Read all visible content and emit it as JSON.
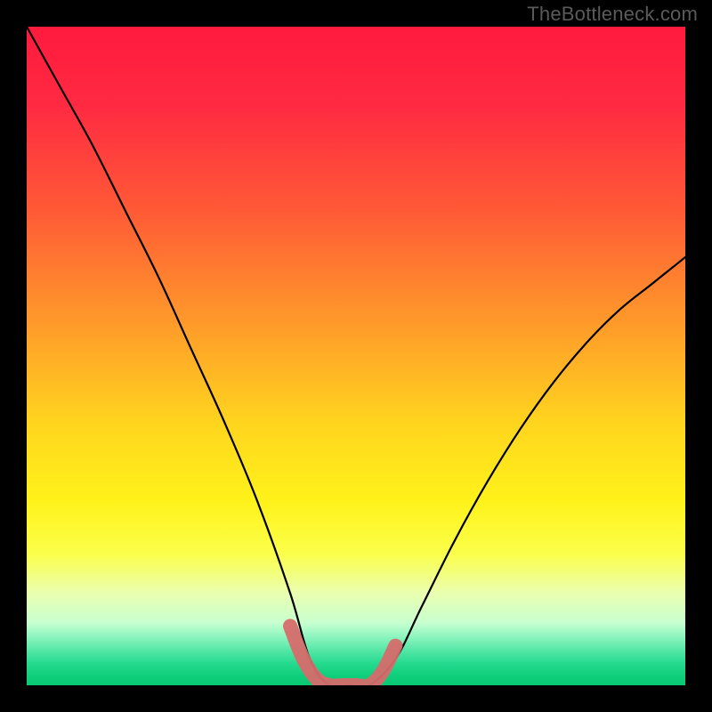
{
  "watermark": "TheBottleneck.com",
  "chart_data": {
    "type": "line",
    "title": "",
    "xlabel": "",
    "ylabel": "",
    "xlim": [
      0,
      100
    ],
    "ylim": [
      0,
      100
    ],
    "series": [
      {
        "name": "bottleneck-curve",
        "x": [
          0,
          5,
          10,
          15,
          20,
          25,
          30,
          35,
          40,
          43,
          46,
          49,
          52,
          56,
          60,
          65,
          70,
          75,
          80,
          85,
          90,
          95,
          100
        ],
        "values": [
          100,
          91,
          82,
          72,
          62,
          51,
          40,
          28,
          14,
          4,
          0,
          0,
          0,
          4,
          12,
          22,
          31,
          39,
          46,
          52,
          57,
          61,
          65
        ]
      }
    ],
    "highlight": {
      "name": "optimal-range",
      "x": [
        40,
        42,
        44,
        46,
        48,
        50,
        52,
        54,
        56
      ],
      "values": [
        9,
        4,
        1,
        0,
        0,
        0,
        0,
        2,
        6
      ]
    },
    "background_gradient": {
      "stops": [
        {
          "offset": 0.0,
          "color": "#ff1a3e"
        },
        {
          "offset": 0.12,
          "color": "#ff2a42"
        },
        {
          "offset": 0.28,
          "color": "#ff5a36"
        },
        {
          "offset": 0.45,
          "color": "#ff9a2a"
        },
        {
          "offset": 0.6,
          "color": "#ffd41e"
        },
        {
          "offset": 0.72,
          "color": "#fff21a"
        },
        {
          "offset": 0.8,
          "color": "#fbff4a"
        },
        {
          "offset": 0.86,
          "color": "#eaffb0"
        },
        {
          "offset": 0.905,
          "color": "#c8ffd0"
        },
        {
          "offset": 0.925,
          "color": "#90f5c0"
        },
        {
          "offset": 0.945,
          "color": "#5ae8a8"
        },
        {
          "offset": 0.965,
          "color": "#28db90"
        },
        {
          "offset": 0.985,
          "color": "#10cf7c"
        },
        {
          "offset": 1.0,
          "color": "#08c872"
        }
      ]
    }
  }
}
